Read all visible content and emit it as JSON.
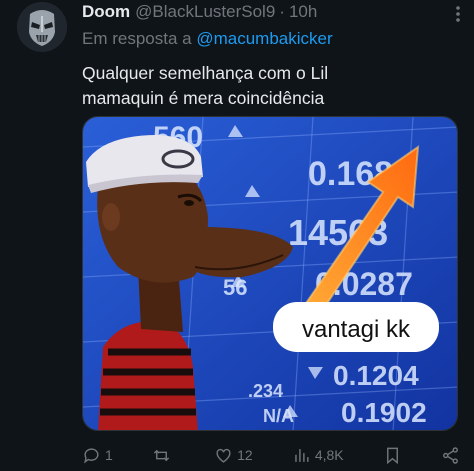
{
  "tweet": {
    "display_name": "Doom",
    "handle": "@BlackLusterSol9",
    "separator": "·",
    "time": "10h",
    "reply_prefix": "Em resposta a",
    "reply_mention": "@macumbakicker",
    "text_line1": "Qualquer semelhança com o Lil",
    "text_line2": "mamaquin é mera coincidência"
  },
  "media": {
    "caption": "vantagi kk",
    "ticker_values": [
      "560",
      "0.168",
      "14563",
      "0.0287",
      "56",
      "0.1204",
      "0.1902",
      "N/A",
      ".234"
    ],
    "colors": {
      "board": "#1a3fb0",
      "arrow": "#ff8a1e",
      "skin": "#5a2f18",
      "cap": "#e9e7ee"
    }
  },
  "actions": {
    "replies": "1",
    "reposts": "",
    "likes": "12",
    "views": "4,8K",
    "icons": [
      "reply-icon",
      "repost-icon",
      "like-icon",
      "views-icon",
      "bookmark-icon",
      "share-icon"
    ]
  },
  "theme": {
    "background": "#0f1419",
    "text": "#e7e9ea",
    "muted": "#71767b",
    "link": "#1d9bf0"
  }
}
